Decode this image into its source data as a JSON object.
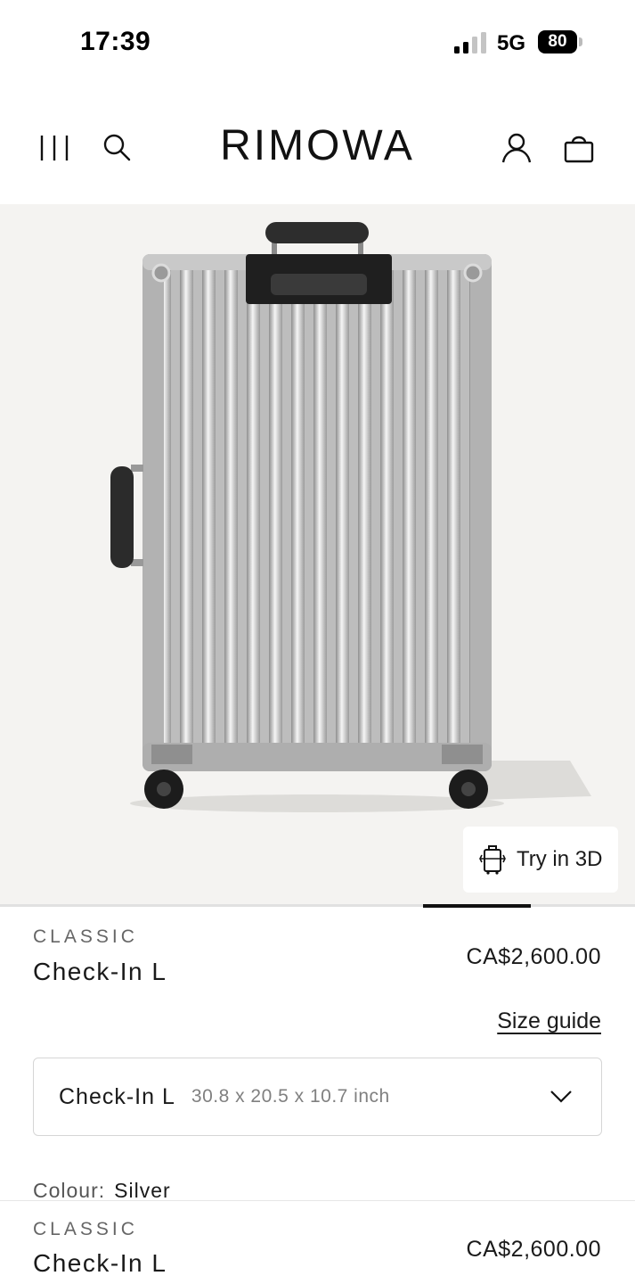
{
  "status_bar": {
    "time": "17:39",
    "network": "5G",
    "battery": "80"
  },
  "header": {
    "brand": "RIMOWA",
    "icons": [
      "menu-icon",
      "search-icon",
      "account-icon",
      "shopping-bag-icon"
    ]
  },
  "hero": {
    "image_subject": "silver aluminium suitcase",
    "try_3d_label": "Try in 3D",
    "gallery_progress": 0.17
  },
  "product": {
    "collection": "CLASSIC",
    "name": "Check-In L",
    "price": "CA$2,600.00",
    "size_guide_label": "Size guide",
    "size_selector": {
      "selected_name": "Check-In L",
      "selected_dimensions": "30.8 x 20.5 x 10.7 inch"
    },
    "colour_label": "Colour:",
    "colour_value": "Silver"
  },
  "sticky_bar": {
    "collection": "CLASSIC",
    "name": "Check-In L",
    "price": "CA$2,600.00"
  },
  "colors": {
    "hero_background": "#f4f3f1",
    "text": "#1a1a1a",
    "muted_text": "#666666",
    "border": "#d6d6d6"
  }
}
